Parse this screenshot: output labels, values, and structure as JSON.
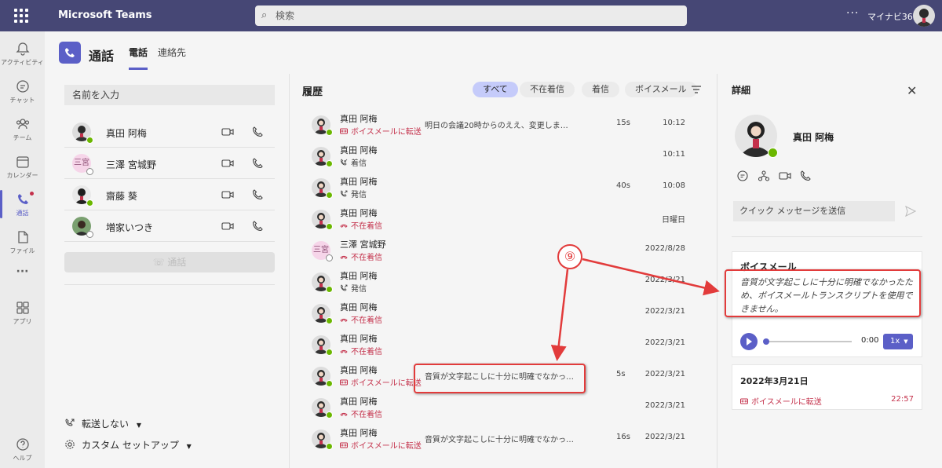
{
  "app": {
    "name": "Microsoft Teams",
    "tenant": "マイナビ365",
    "more": "···"
  },
  "search": {
    "placeholder": "検索"
  },
  "rail": [
    {
      "label": "アクティビティ"
    },
    {
      "label": "チャット"
    },
    {
      "label": "チーム"
    },
    {
      "label": "カレンダー"
    },
    {
      "label": "通話"
    },
    {
      "label": "ファイル"
    },
    {
      "label": "···"
    },
    {
      "label": "アプリ"
    },
    {
      "label": "ヘルプ"
    }
  ],
  "header": {
    "title": "通話",
    "tabs": [
      "電話",
      "連絡先"
    ]
  },
  "left": {
    "name_placeholder": "名前を入力",
    "contacts": [
      {
        "name": "真田 阿梅",
        "status": "available"
      },
      {
        "name": "三澤 宮城野",
        "status": "offline",
        "initials": "三宮"
      },
      {
        "name": "齋藤 葵",
        "status": "available"
      },
      {
        "name": "増家いつき",
        "status": "offline"
      }
    ],
    "call_button": "通話",
    "forward": "転送しない",
    "custom_setup": "カスタム セットアップ"
  },
  "history": {
    "title": "履歴",
    "filters": [
      "すべて",
      "不在着信",
      "着信",
      "ボイスメール"
    ],
    "rows": [
      {
        "name": "真田 阿梅",
        "status": "ボイスメールに転送",
        "type": "voicemail",
        "transcript": "明日の会議20時からのええ、変更しまし...",
        "duration": "15s",
        "time": "10:12"
      },
      {
        "name": "真田 阿梅",
        "status": "着信",
        "type": "incoming",
        "transcript": "",
        "duration": "",
        "time": "10:11"
      },
      {
        "name": "真田 阿梅",
        "status": "発信",
        "type": "outgoing",
        "transcript": "",
        "duration": "40s",
        "time": "10:08"
      },
      {
        "name": "真田 阿梅",
        "status": "不在着信",
        "type": "missed",
        "transcript": "",
        "duration": "",
        "time": "日曜日"
      },
      {
        "name": "三澤 宮城野",
        "status": "不在着信",
        "type": "missed",
        "transcript": "",
        "duration": "",
        "time": "2022/8/28",
        "initials": "三宮"
      },
      {
        "name": "真田 阿梅",
        "status": "発信",
        "type": "outgoing",
        "transcript": "",
        "duration": "",
        "time": "2022/3/21"
      },
      {
        "name": "真田 阿梅",
        "status": "不在着信",
        "type": "missed",
        "transcript": "",
        "duration": "",
        "time": "2022/3/21"
      },
      {
        "name": "真田 阿梅",
        "status": "不在着信",
        "type": "missed",
        "transcript": "",
        "duration": "",
        "time": "2022/3/21"
      },
      {
        "name": "真田 阿梅",
        "status": "ボイスメールに転送",
        "type": "voicemail",
        "transcript": "音質が文字起こしに十分に明確でなかったた...",
        "duration": "5s",
        "time": "2022/3/21"
      },
      {
        "name": "真田 阿梅",
        "status": "不在着信",
        "type": "missed",
        "transcript": "",
        "duration": "",
        "time": "2022/3/21"
      },
      {
        "name": "真田 阿梅",
        "status": "ボイスメールに転送",
        "type": "voicemail",
        "transcript": "音質が文字起こしに十分に明確でなかったた...",
        "duration": "16s",
        "time": "2022/3/21"
      }
    ]
  },
  "details": {
    "title": "詳細",
    "name": "真田 阿梅",
    "quick_message_placeholder": "クイック メッセージを送信",
    "voicemail": {
      "title": "ボイスメール",
      "transcript": "音質が文字起こしに十分に明確でなかったため、ボイスメールトランスクリプトを使用できません。",
      "current_time": "0:00",
      "speed": "1x"
    },
    "entry": {
      "date": "2022年3月21日",
      "status": "ボイスメールに転送",
      "time": "22:57"
    }
  },
  "annotation": {
    "marker": "⑨"
  }
}
